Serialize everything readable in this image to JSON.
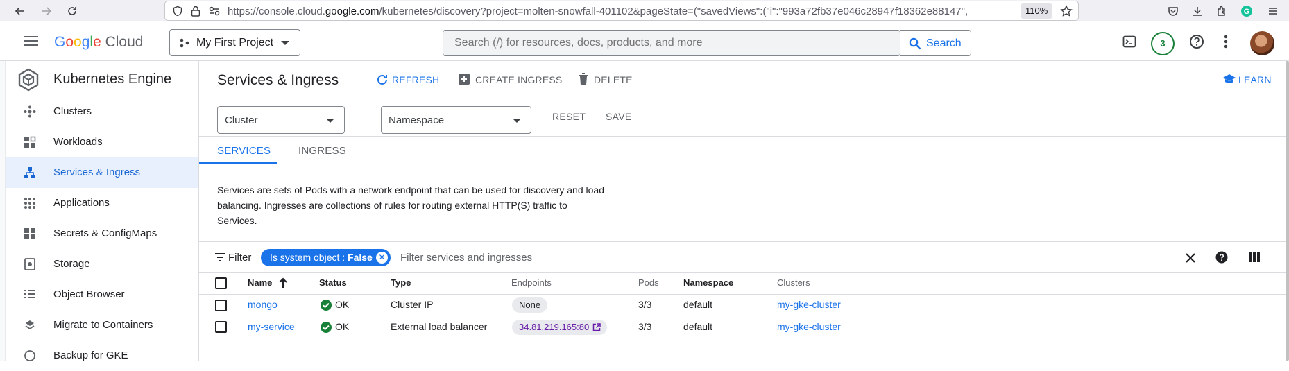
{
  "browser": {
    "url_prefix": "https://console.cloud.",
    "url_host": "google.com",
    "url_rest": "/kubernetes/discovery?project=molten-snowfall-401102&pageState=(\"savedViews\":(\"i\":\"993a72fb37e046c28947f18362e88147\",",
    "zoom": "110%"
  },
  "header": {
    "logo_text": "Google Cloud",
    "project": "My First Project",
    "search_placeholder": "Search (/) for resources, docs, products, and more",
    "search_button": "Search",
    "notifications_count": "3"
  },
  "sidebar": {
    "product_title": "Kubernetes Engine",
    "items": [
      {
        "label": "Clusters",
        "icon": "clusters-icon"
      },
      {
        "label": "Workloads",
        "icon": "workloads-icon"
      },
      {
        "label": "Services & Ingress",
        "icon": "services-icon",
        "active": true
      },
      {
        "label": "Applications",
        "icon": "applications-icon"
      },
      {
        "label": "Secrets & ConfigMaps",
        "icon": "secrets-icon"
      },
      {
        "label": "Storage",
        "icon": "storage-icon"
      },
      {
        "label": "Object Browser",
        "icon": "object-browser-icon"
      },
      {
        "label": "Migrate to Containers",
        "icon": "migrate-icon"
      },
      {
        "label": "Backup for GKE",
        "icon": "backup-icon"
      }
    ]
  },
  "page": {
    "title": "Services & Ingress",
    "refresh": "REFRESH",
    "create_ingress": "CREATE INGRESS",
    "delete": "DELETE",
    "learn": "LEARN",
    "cluster_select": "Cluster",
    "namespace_select": "Namespace",
    "reset": "RESET",
    "save": "SAVE",
    "tabs": [
      "SERVICES",
      "INGRESS"
    ],
    "description": "Services are sets of Pods with a network endpoint that can be used for discovery and load balancing. Ingresses are collections of rules for routing external HTTP(S) traffic to Services."
  },
  "filter": {
    "label": "Filter",
    "chip_key": "Is system object : ",
    "chip_value": "False",
    "placeholder": "Filter services and ingresses"
  },
  "table": {
    "columns": [
      "Name",
      "Status",
      "Type",
      "Endpoints",
      "Pods",
      "Namespace",
      "Clusters"
    ],
    "rows": [
      {
        "name": "mongo",
        "status": "OK",
        "type": "Cluster IP",
        "endpoints": "None",
        "pods": "3/3",
        "namespace": "default",
        "cluster": "my-gke-cluster"
      },
      {
        "name": "my-service",
        "status": "OK",
        "type": "External load balancer",
        "endpoints": "34.81.219.165:80",
        "pods": "3/3",
        "namespace": "default",
        "cluster": "my-gke-cluster"
      }
    ]
  },
  "colors": {
    "accent": "#1a73e8",
    "ok": "#188038"
  }
}
